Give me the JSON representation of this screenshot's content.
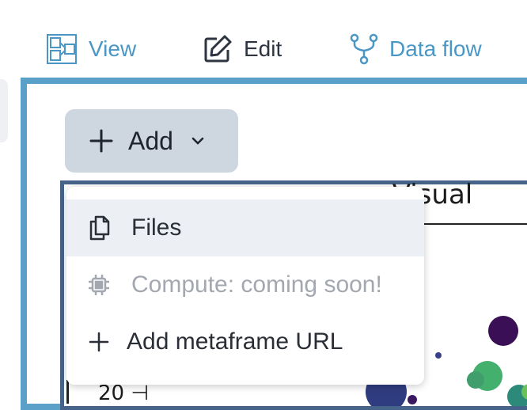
{
  "tabs": [
    {
      "label": "View",
      "icon": "view-layout-icon",
      "color": "#4a97c6"
    },
    {
      "label": "Edit",
      "icon": "edit-icon",
      "color": "#2e3440"
    },
    {
      "label": "Data flow",
      "icon": "data-flow-icon",
      "color": "#4a97c6"
    }
  ],
  "toolbar": {
    "add_label": "Add",
    "add_icon": "plus-icon",
    "dropdown_icon": "chevron-down-icon"
  },
  "add_menu": {
    "items": [
      {
        "label": "Files",
        "icon": "files-icon",
        "state": "highlighted"
      },
      {
        "label": "Compute: coming soon!",
        "icon": "chip-icon",
        "state": "disabled"
      },
      {
        "label": "Add metaframe URL",
        "icon": "plus-icon",
        "state": "normal"
      }
    ]
  },
  "plot_preview": {
    "title_fragment": "e Visual",
    "y_tick_label": "20"
  },
  "colors": {
    "accent": "#4a97c6",
    "frame_border": "#5aa0c8",
    "button_bg": "#ced6e0",
    "menu_highlight": "#eceff4"
  }
}
